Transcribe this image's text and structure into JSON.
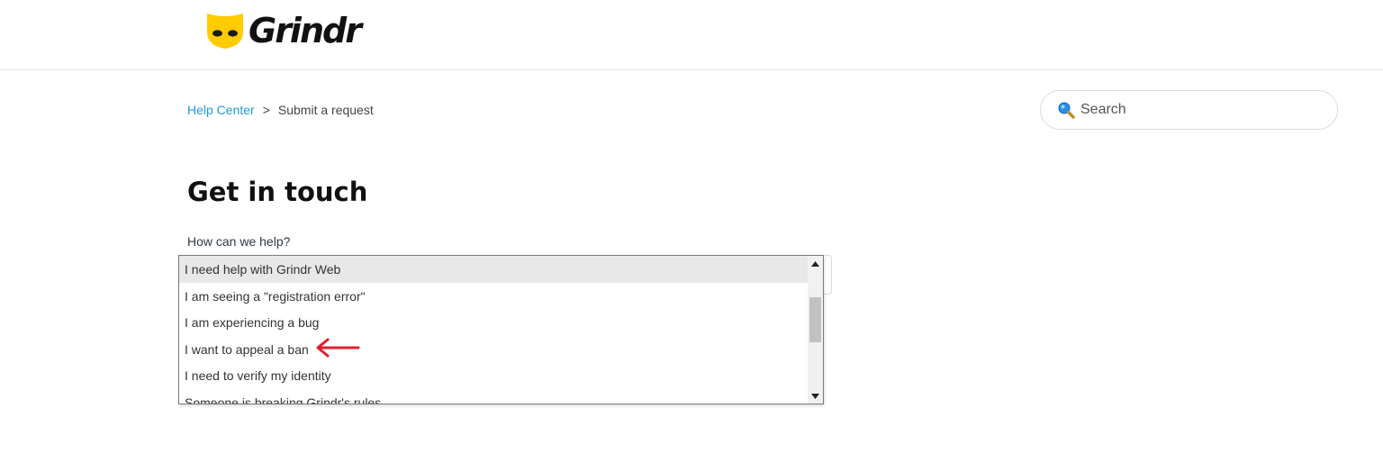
{
  "brand": {
    "name": "Grindr",
    "accent_color": "#ffcc00"
  },
  "breadcrumb": {
    "home": "Help Center",
    "separator": ">",
    "current": "Submit a request"
  },
  "search": {
    "placeholder": "Search",
    "icon": "magnifier-icon"
  },
  "page": {
    "title": "Get in touch",
    "field_label": "How can we help?"
  },
  "dropdown": {
    "selected_index": 0,
    "options": [
      "I need help with Grindr Web",
      "I am seeing a \"registration error\"",
      "I am experiencing a bug",
      "I want to appeal a ban",
      "I need to verify my identity",
      "Someone is breaking Grindr's rules"
    ]
  },
  "annotation": {
    "type": "arrow",
    "color": "#e0202c",
    "points_to": "I want to appeal a ban"
  }
}
